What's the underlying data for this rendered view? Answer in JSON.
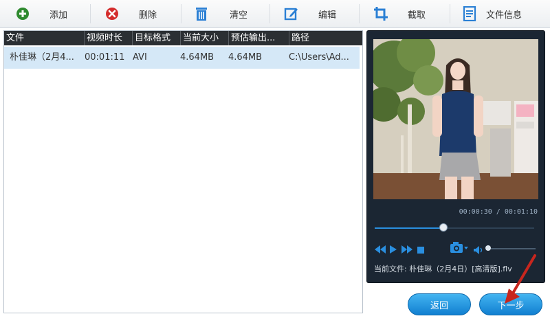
{
  "toolbar": {
    "add": {
      "label": "添加",
      "icon": "plus-circle-icon",
      "color": "#2f8a2f"
    },
    "delete": {
      "label": "删除",
      "icon": "x-circle-icon",
      "color": "#d42c2c"
    },
    "clear": {
      "label": "清空",
      "icon": "trash-icon",
      "color": "#2a7fd4"
    },
    "edit": {
      "label": "编辑",
      "icon": "edit-icon",
      "color": "#2a7fd4"
    },
    "crop": {
      "label": "截取",
      "icon": "crop-icon",
      "color": "#2a7fd4"
    },
    "info": {
      "label": "文件信息",
      "icon": "document-icon",
      "color": "#2a7fd4"
    }
  },
  "table": {
    "columns": [
      "文件",
      "视频时长",
      "目标格式",
      "当前大小",
      "预估输出...",
      "路径"
    ],
    "rows": [
      {
        "file": "朴佳琳（2月4...",
        "duration": "00:01:11",
        "format": "AVI",
        "size": "4.64MB",
        "output": "4.64MB",
        "path": "C:\\Users\\Ad..."
      }
    ]
  },
  "preview": {
    "time": "00:00:30 / 00:01:10",
    "progress": 0.43,
    "volume": 0.0,
    "current_file": "当前文件: 朴佳琳（2月4日）[高清版].flv"
  },
  "buttons": {
    "back": "返回",
    "next": "下一步"
  },
  "colors": {
    "accent": "#1e90e6",
    "header_bg": "#2b2f33",
    "selected_row": "#d5e8f7",
    "panel_bg": "#1b2633"
  }
}
